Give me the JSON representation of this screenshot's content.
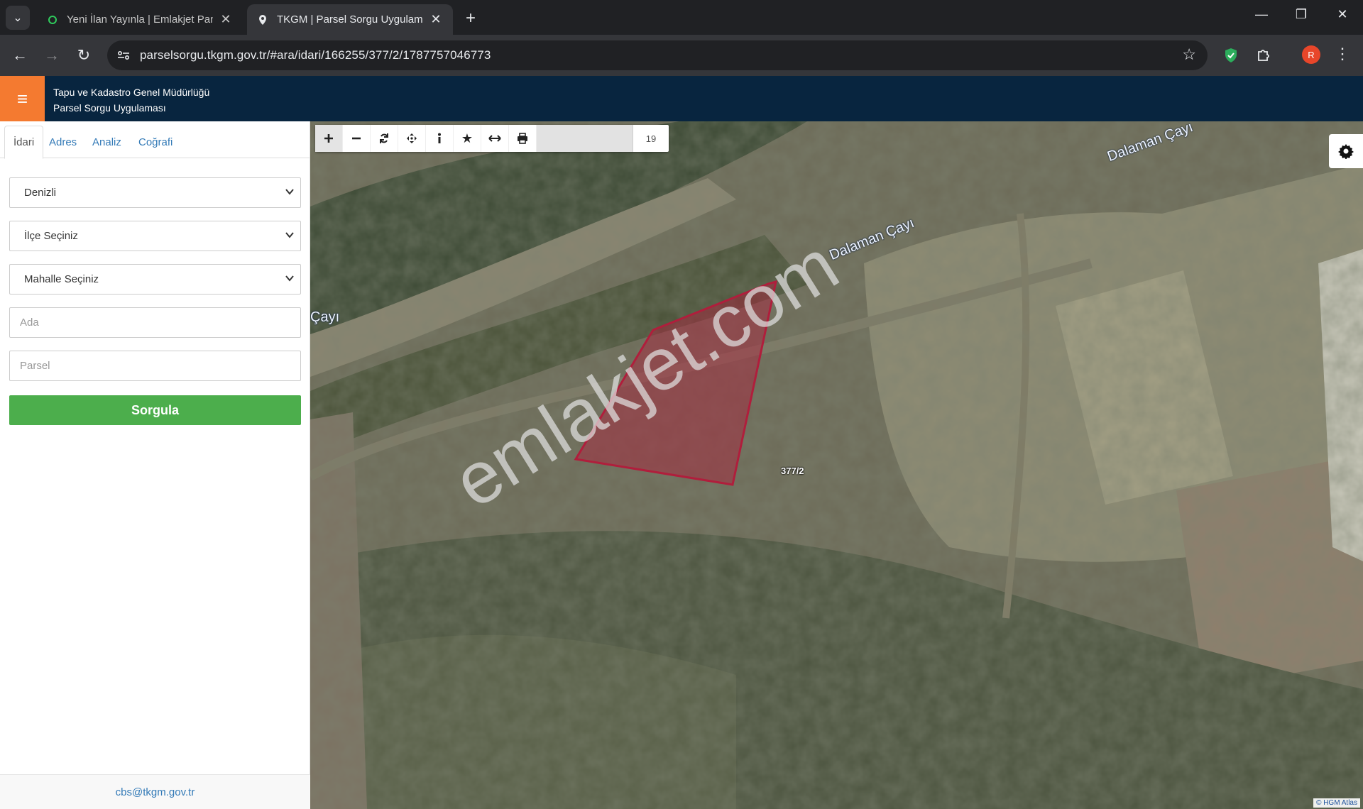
{
  "browser": {
    "tabs": [
      {
        "title": "Yeni İlan Yayınla | Emlakjet Panel",
        "active": false
      },
      {
        "title": "TKGM | Parsel Sorgu Uygulaması",
        "active": true
      }
    ],
    "url": "parselsorgu.tkgm.gov.tr/#ara/idari/166255/377/2/1787757046773",
    "profile_initial": "R"
  },
  "app": {
    "title_line1": "Tapu ve Kadastro Genel Müdürlüğü",
    "title_line2": "Parsel Sorgu Uygulaması",
    "accent_color": "#f47a30",
    "header_color": "#08253f"
  },
  "sidebar": {
    "tabs": [
      "İdari",
      "Adres",
      "Analiz",
      "Coğrafi"
    ],
    "active_tab": "İdari",
    "province_select": "Denizli",
    "district_select": "İlçe Seçiniz",
    "neighborhood_select": "Mahalle Seçiniz",
    "ada_placeholder": "Ada",
    "parsel_placeholder": "Parsel",
    "submit_label": "Sorgula",
    "footer_email": "cbs@tkgm.gov.tr"
  },
  "map": {
    "zoom_level": "19",
    "tools": [
      "zoom-in-icon",
      "zoom-out-icon",
      "refresh-icon",
      "pan-icon",
      "info-icon",
      "star-icon",
      "measure-icon",
      "print-icon"
    ],
    "labels": {
      "river_top": "Dalaman Çayı",
      "river_mid": "Dalaman Çayı",
      "river_left": "Çayı"
    },
    "parcel_label": "377/2",
    "parcel_color": "#b01e3c",
    "watermark": "emlakjet.com",
    "attribution": "© HGM Atlas"
  }
}
